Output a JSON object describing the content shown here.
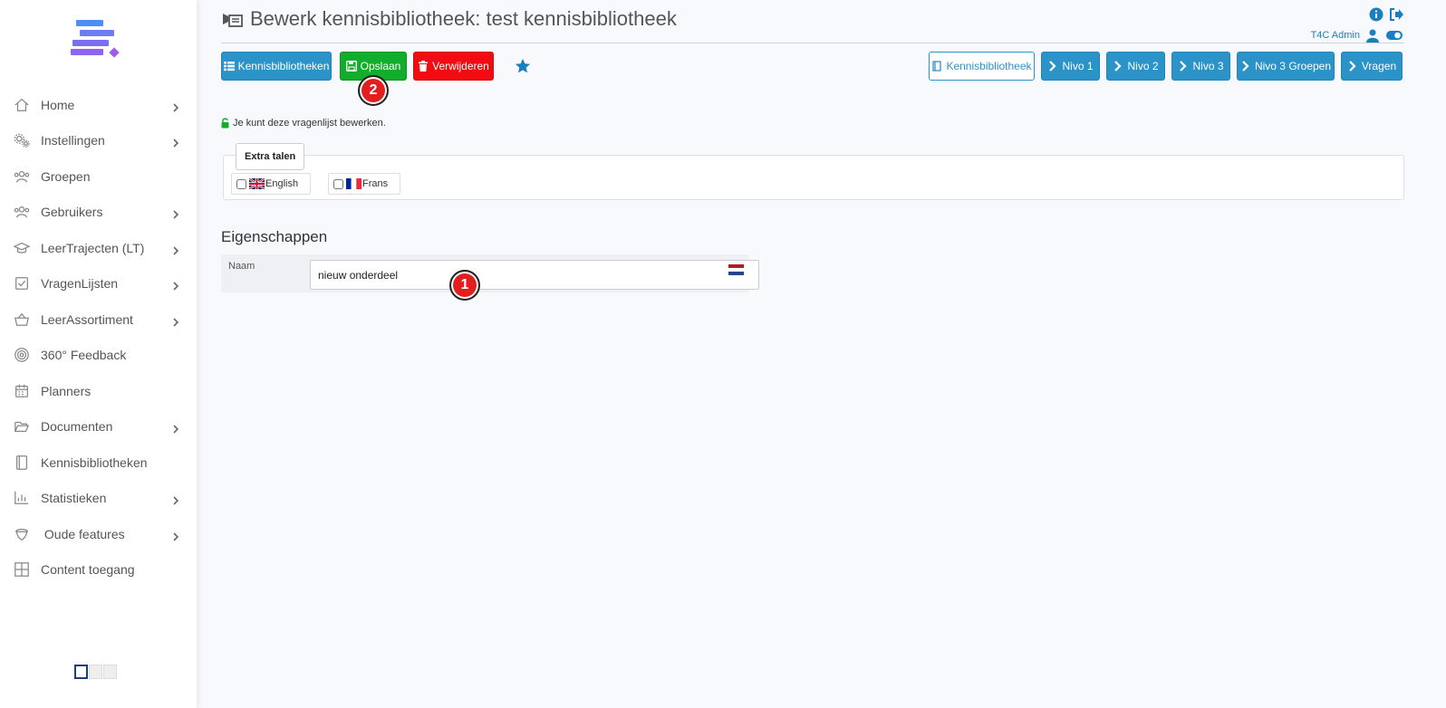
{
  "sidebar": {
    "items": [
      {
        "label": "Home",
        "icon": "home-icon",
        "has_children": true
      },
      {
        "label": "Instellingen",
        "icon": "gears-icon",
        "has_children": true
      },
      {
        "label": "Groepen",
        "icon": "users-icon",
        "has_children": false
      },
      {
        "label": "Gebruikers",
        "icon": "users-icon",
        "has_children": true
      },
      {
        "label": "LeerTrajecten (LT)",
        "icon": "graduation-cap-icon",
        "has_children": true
      },
      {
        "label": "VragenLijsten",
        "icon": "checkbox-icon",
        "has_children": true
      },
      {
        "label": "LeerAssortiment",
        "icon": "basket-icon",
        "has_children": true
      },
      {
        "label": "360° Feedback",
        "icon": "target-icon",
        "has_children": false
      },
      {
        "label": "Planners",
        "icon": "calendar-icon",
        "has_children": false
      },
      {
        "label": "Documenten",
        "icon": "folder-open-icon",
        "has_children": true
      },
      {
        "label": "Kennisbibliotheken",
        "icon": "book-icon",
        "has_children": false
      },
      {
        "label": "Statistieken",
        "icon": "bar-chart-icon",
        "has_children": true
      },
      {
        "label": " Oude features",
        "icon": "acorn-icon",
        "has_children": true
      },
      {
        "label": "Content toegang",
        "icon": "grid-icon",
        "has_children": false
      }
    ]
  },
  "header": {
    "title": "Bewerk kennisbibliotheek: test kennisbibliotheek",
    "user": "T4C Admin"
  },
  "toolbar": {
    "kennisbibliotheken": "Kennisbibliotheken",
    "opslaan": "Opslaan",
    "verwijderen": "Verwijderen",
    "nav": [
      "Kennisbibliotheek",
      "Nivo 1",
      "Nivo 2",
      "Nivo 3",
      "Nivo 3 Groepen",
      "Vragen"
    ]
  },
  "markers": {
    "one": "1",
    "two": "2"
  },
  "notice": "Je kunt deze vragenlijst bewerken.",
  "languages": {
    "legend": "Extra talen",
    "options": [
      {
        "label": "English",
        "checked": false
      },
      {
        "label": "Frans",
        "checked": false
      }
    ]
  },
  "properties": {
    "title": "Eigenschappen",
    "name_label": "Naam",
    "name_value": "nieuw onderdeel"
  },
  "colors": {
    "primary": "#2c93c9",
    "success": "#12ad2b",
    "danger": "#f20c12",
    "marker": "#e31e1e"
  }
}
